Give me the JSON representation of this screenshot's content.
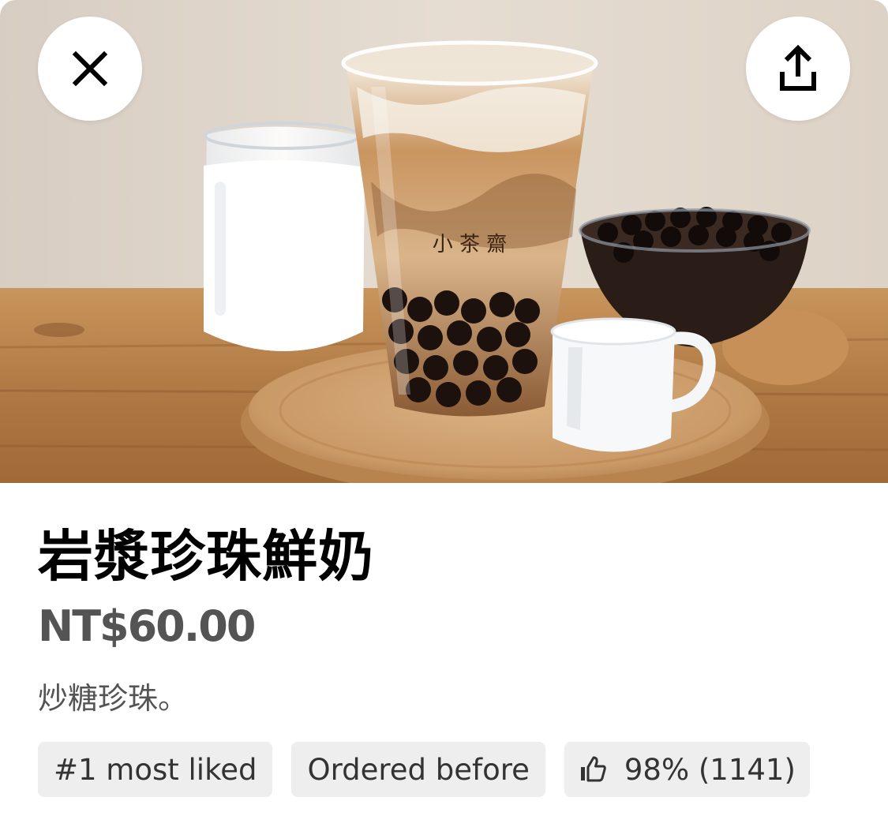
{
  "item": {
    "name": "岩漿珍珠鮮奶",
    "price": "NT$60.00",
    "description": "炒糖珍珠。"
  },
  "header": {
    "close_icon": "close-icon",
    "share_icon": "share-icon"
  },
  "badges": {
    "most_liked": "#1 most liked",
    "ordered_before": "Ordered before",
    "rating_icon": "thumbs-up-icon",
    "rating": "98% (1141)"
  },
  "photo": {
    "cup_print": "小 茶 齋"
  },
  "colors": {
    "price_text": "#545454",
    "chip_background": "#eeeeee",
    "chip_text": "#333333"
  }
}
